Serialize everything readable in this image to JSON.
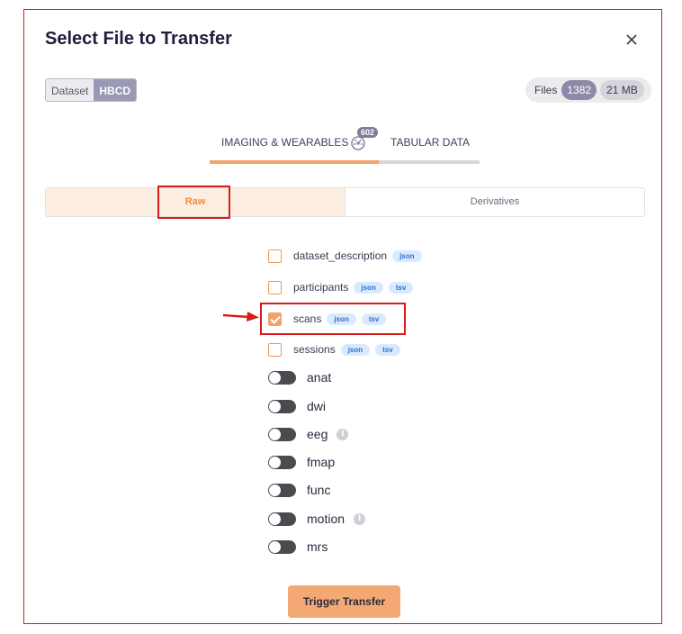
{
  "modal": {
    "title": "Select File to Transfer",
    "close_icon": "close-icon"
  },
  "dataset": {
    "key": "Dataset",
    "value": "HBCD"
  },
  "files": {
    "label": "Files",
    "count": "1382",
    "size": "21 MB"
  },
  "tabs": [
    {
      "label": "IMAGING & WEARABLES",
      "icon": "dashboard-gauge-icon",
      "badge": "602",
      "active": true
    },
    {
      "label": "TABULAR DATA",
      "active": false
    }
  ],
  "segments": [
    {
      "label": "Raw",
      "active": true
    },
    {
      "label": "Derivatives",
      "active": false
    }
  ],
  "file_items": [
    {
      "name": "dataset_description",
      "tags": [
        "json"
      ],
      "checked": false
    },
    {
      "name": "participants",
      "tags": [
        "json",
        "tsv"
      ],
      "checked": false
    },
    {
      "name": "scans",
      "tags": [
        "json",
        "tsv"
      ],
      "checked": true
    },
    {
      "name": "sessions",
      "tags": [
        "json",
        "tsv"
      ],
      "checked": false
    }
  ],
  "modalities": [
    {
      "name": "anat",
      "info": false
    },
    {
      "name": "dwi",
      "info": false
    },
    {
      "name": "eeg",
      "info": true,
      "info_glyph": "i"
    },
    {
      "name": "fmap",
      "info": false
    },
    {
      "name": "func",
      "info": false
    },
    {
      "name": "motion",
      "info": true,
      "info_glyph": "i"
    },
    {
      "name": "mrs",
      "info": false
    }
  ],
  "footer": {
    "button_label": "Trigger Transfer"
  },
  "colors": {
    "accent_orange": "#f0a46a",
    "highlight_red": "#d91a1a",
    "tag_blue": "#2a6fd6",
    "toggle_off": "#4a4a50"
  }
}
